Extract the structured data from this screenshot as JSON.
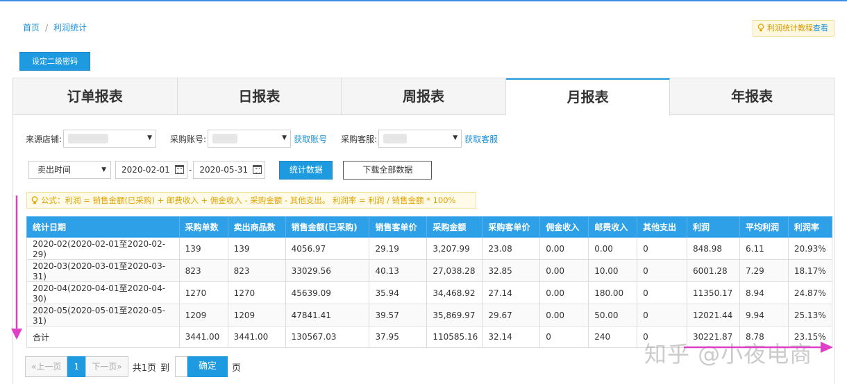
{
  "breadcrumb": {
    "home": "首页",
    "separator": "/",
    "current": "利润统计"
  },
  "tutorial": {
    "icon": "lightbulb-icon",
    "prefix": "利润统计教程",
    "link": "查看"
  },
  "password_button": "设定二级密码",
  "tabs": [
    {
      "label": "订单报表",
      "active": false
    },
    {
      "label": "日报表",
      "active": false
    },
    {
      "label": "周报表",
      "active": false
    },
    {
      "label": "月报表",
      "active": true
    },
    {
      "label": "年报表",
      "active": false
    }
  ],
  "filters": {
    "source_shop_label": "来源店铺:",
    "purchase_account_label": "采购账号:",
    "get_account_link": "获取账号",
    "purchase_service_label": "采购客服:",
    "get_service_link": "获取客服"
  },
  "date_filter": {
    "type_value": "卖出时间",
    "start_date": "2020-02-01",
    "dash": "-",
    "end_date": "2020-05-31",
    "stat_button": "统计数据",
    "download_button": "下载全部数据"
  },
  "formula_note": "公式：利润 = 销售金额(已采购) + 邮费收入 + 佣金收入 - 采购金额 - 其他支出。 利润率 = 利润 / 销售金额 * 100%",
  "table": {
    "headers": [
      "统计日期",
      "采购单数",
      "卖出商品数",
      "销售金额(已采购)",
      "销售客单价",
      "采购金额",
      "采购客单价",
      "佣金收入",
      "邮费收入",
      "其他支出",
      "利润",
      "平均利润",
      "利润率"
    ],
    "rows": [
      [
        "2020-02(2020-02-01至2020-02-29)",
        "139",
        "139",
        "4056.97",
        "29.19",
        "3,207.99",
        "23.08",
        "0.00",
        "0.00",
        "0",
        "848.98",
        "6.11",
        "20.93%"
      ],
      [
        "2020-03(2020-03-01至2020-03-31)",
        "823",
        "823",
        "33029.56",
        "40.13",
        "27,038.28",
        "32.85",
        "0.00",
        "10.00",
        "0",
        "6001.28",
        "7.29",
        "18.17%"
      ],
      [
        "2020-04(2020-04-01至2020-04-30)",
        "1270",
        "1270",
        "45639.09",
        "35.94",
        "34,468.92",
        "27.14",
        "0.00",
        "180.00",
        "0",
        "11350.17",
        "8.94",
        "24.87%"
      ],
      [
        "2020-05(2020-05-01至2020-05-31)",
        "1209",
        "1209",
        "47841.41",
        "39.57",
        "35,869.97",
        "29.67",
        "0.00",
        "50.00",
        "0",
        "12021.44",
        "9.94",
        "25.13%"
      ],
      [
        "合计",
        "3441.00",
        "3441.00",
        "130567.03",
        "37.95",
        "110585.16",
        "32.14",
        "0",
        "240",
        "0",
        "30221.87",
        "8.78",
        "23.15%"
      ]
    ]
  },
  "pagination": {
    "prev": "«上一页",
    "current": "1",
    "next": "下一页»",
    "total": "共1页",
    "goto": "到",
    "confirm": "确定",
    "page_unit": "页"
  },
  "watermark": "知乎 @小夜电商",
  "colors": {
    "accent": "#1e9be0",
    "arrow": "#e040c8",
    "note": "#e0a200"
  }
}
